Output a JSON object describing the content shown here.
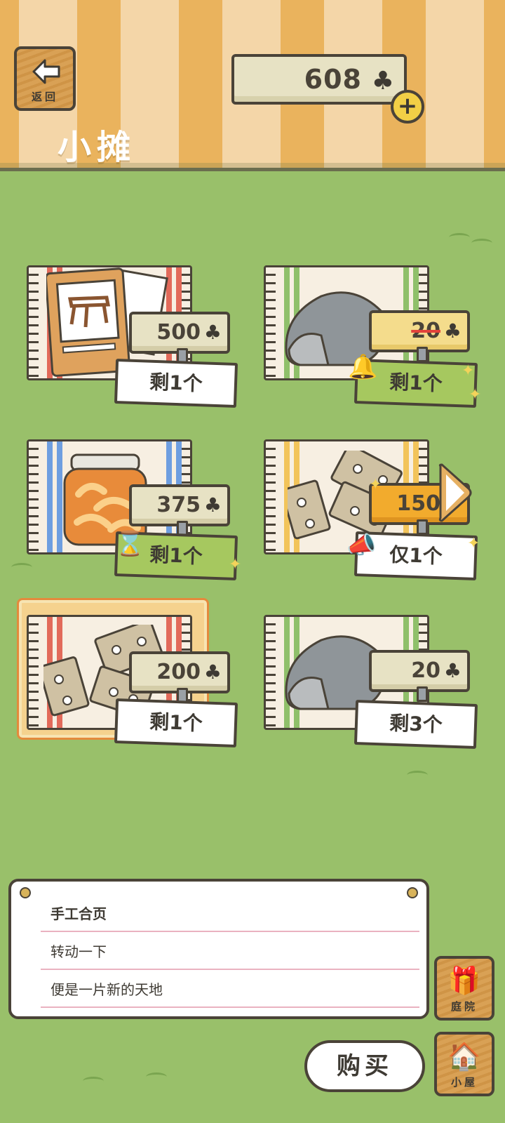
{
  "header": {
    "back_label": "返回",
    "title": "小摊",
    "currency_value": "608",
    "currency_icon": "clover-icon",
    "add_icon": "plus-icon"
  },
  "items": [
    {
      "name_icon": "book-icon",
      "price": "500",
      "stock": "剩1个",
      "price_style": "normal",
      "stock_style": "white",
      "badge": ""
    },
    {
      "name_icon": "rock-icon",
      "price": "20",
      "stock": "剩1个",
      "price_style": "sale",
      "stock_style": "green",
      "badge": "bell-icon"
    },
    {
      "name_icon": "jar-icon",
      "price": "375",
      "stock": "剩1个",
      "price_style": "normal",
      "stock_style": "green",
      "badge": "hourglass-icon"
    },
    {
      "name_icon": "hinge-icon",
      "price": "150",
      "stock": "仅1个",
      "price_style": "hot",
      "stock_style": "white",
      "badge": "megaphone-icon"
    },
    {
      "name_icon": "hinge-icon",
      "price": "200",
      "stock": "剩1个",
      "price_style": "normal",
      "stock_style": "white",
      "badge": "",
      "selected": true
    },
    {
      "name_icon": "rock-icon",
      "price": "20",
      "stock": "剩3个",
      "price_style": "normal",
      "stock_style": "white",
      "badge": ""
    }
  ],
  "description": {
    "item_name": "手工合页",
    "line1": "转动一下",
    "line2": "便是一片新的天地"
  },
  "side_nav": {
    "yard_label": "庭院",
    "house_label": "小屋"
  },
  "buy_label": "购买",
  "colors": {
    "grass": "#99c06a",
    "stripe_orange": "#eab35d",
    "stripe_cream": "#f4d6a8",
    "outline": "#4a4338",
    "selected_border": "#e48a3c"
  }
}
